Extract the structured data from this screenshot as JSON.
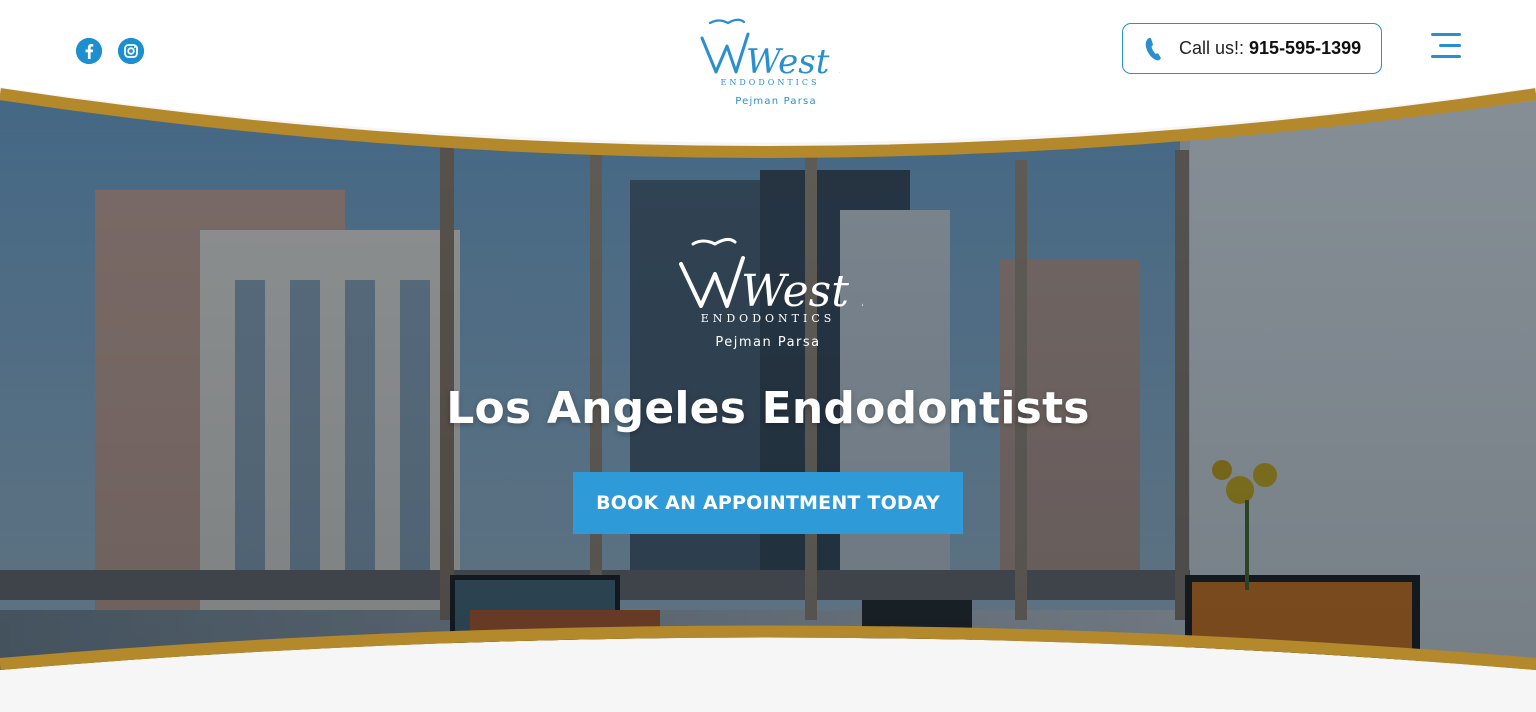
{
  "header": {
    "social": [
      {
        "name": "facebook-icon"
      },
      {
        "name": "instagram-icon"
      }
    ],
    "logo": {
      "brand": "West LA",
      "sub": "ENDODONTICS",
      "doctor": "Pejman Parsa"
    },
    "call": {
      "label": "Call us!:",
      "number": "915-595-1399"
    },
    "menu_icon": "hamburger-menu-icon"
  },
  "hero": {
    "logo": {
      "brand": "West LA",
      "sub": "ENDODONTICS",
      "doctor": "Pejman Parsa"
    },
    "title": "Los Angeles Endodontists",
    "cta": "BOOK AN APPOINTMENT TODAY"
  },
  "colors": {
    "accent": "#2e9ad8",
    "gold": "#b4892b",
    "logo_blue": "#2a8fcf"
  }
}
